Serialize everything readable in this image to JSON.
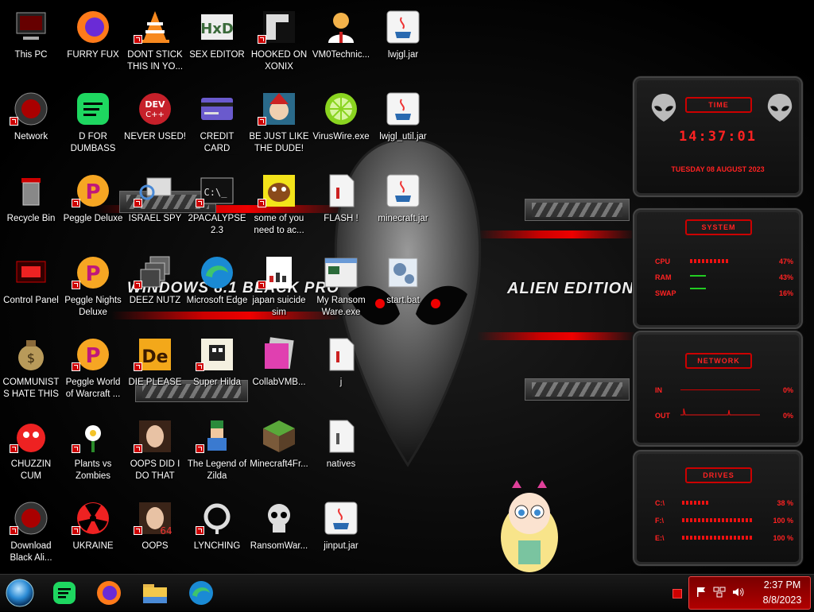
{
  "wallpaper": {
    "left_text": "WINDOWS 8.1 BLACK PRO",
    "right_text": "ALIEN EDITION 20",
    "accent": "#cc0000"
  },
  "desktop_icons": [
    {
      "label": "This PC",
      "icon": "computer-icon"
    },
    {
      "label": "Network",
      "icon": "network-icon"
    },
    {
      "label": "Recycle Bin",
      "icon": "recycle-bin-icon"
    },
    {
      "label": "Control Panel",
      "icon": "control-panel-icon"
    },
    {
      "label": "COMMUNISTS HATE THIS G...",
      "icon": "money-bag-icon"
    },
    {
      "label": "CHUZZIN CUM",
      "icon": "chuzzle-icon"
    },
    {
      "label": "Download Black Ali...",
      "icon": "alien-icon"
    },
    {
      "label": "FURRY FUX",
      "icon": "firefox-icon"
    },
    {
      "label": "D FOR DUMBASS",
      "icon": "spotify-icon"
    },
    {
      "label": "Peggle Deluxe",
      "icon": "peggle-icon"
    },
    {
      "label": "Peggle Nights Deluxe",
      "icon": "peggle-icon"
    },
    {
      "label": "Peggle World of Warcraft ...",
      "icon": "peggle-icon"
    },
    {
      "label": "Plants vs Zombies",
      "icon": "flower-icon"
    },
    {
      "label": "UKRAINE",
      "icon": "radiation-icon"
    },
    {
      "label": "DONT STICK THIS IN YO...",
      "icon": "vlc-cone-icon"
    },
    {
      "label": "NEVER USED!",
      "icon": "dev-cpp-icon"
    },
    {
      "label": "ISRAEL SPY",
      "icon": "magnifier-icon"
    },
    {
      "label": "DEEZ NUTZ",
      "icon": "stacked-windows-icon"
    },
    {
      "label": "DIE PLEASE",
      "icon": "director-icon"
    },
    {
      "label": "OOPS DID I DO THAT",
      "icon": "portrait-icon"
    },
    {
      "label": "OOPS",
      "icon": "portrait-icon"
    },
    {
      "label": "SEX EDITOR",
      "icon": "hxd-icon"
    },
    {
      "label": "CREDIT CARD CHECKER",
      "icon": "credit-card-icon"
    },
    {
      "label": "2PACALYPSE 2.3",
      "icon": "terminal-icon"
    },
    {
      "label": "Microsoft Edge",
      "icon": "edge-icon"
    },
    {
      "label": "Super Hilda",
      "icon": "pixel-game-icon"
    },
    {
      "label": "The Legend of Zilda",
      "icon": "pixel-hero-icon"
    },
    {
      "label": "LYNCHING",
      "icon": "rope-icon"
    },
    {
      "label": "HOOKED ON XONIX",
      "icon": "xonix-icon"
    },
    {
      "label": "BE JUST LIKE THE DUDE!",
      "icon": "elf-icon"
    },
    {
      "label": "some of you need to ac...",
      "icon": "dog-icon"
    },
    {
      "label": "japan suicide sim",
      "icon": "document-icon"
    },
    {
      "label": "CollabVMB...",
      "icon": "folder-pink-icon"
    },
    {
      "label": "Minecraft4Fr...",
      "icon": "grass-block-icon"
    },
    {
      "label": "RansomWar...",
      "icon": "skull-icon"
    },
    {
      "label": "VM0Technic...",
      "icon": "doctor-icon"
    },
    {
      "label": "VirusWire.exe",
      "icon": "lime-icon"
    },
    {
      "label": "FLASH !",
      "icon": "file-icon"
    },
    {
      "label": "My Ransom Ware.exe",
      "icon": "app-window-icon"
    },
    {
      "label": "j",
      "icon": "file-icon"
    },
    {
      "label": "natives",
      "icon": "file-icon"
    },
    {
      "label": "jinput.jar",
      "icon": "java-icon"
    },
    {
      "label": "lwjgl.jar",
      "icon": "java-icon"
    },
    {
      "label": "lwjgl_util.jar",
      "icon": "java-icon"
    },
    {
      "label": "minecraft.jar",
      "icon": "java-icon"
    },
    {
      "label": "start.bat",
      "icon": "batch-gear-icon"
    }
  ],
  "gadgets": {
    "time": {
      "title": "TIME",
      "clock": "14:37:01",
      "date": "TUESDAY 08 AUGUST 2023"
    },
    "system": {
      "title": "SYSTEM",
      "rows": [
        {
          "label": "CPU",
          "value": "47%",
          "fill": 0.47
        },
        {
          "label": "RAM",
          "value": "43%",
          "fill": 0.43
        },
        {
          "label": "SWAP",
          "value": "16%",
          "fill": 0.16
        }
      ]
    },
    "network": {
      "title": "NETWORK",
      "rows": [
        {
          "label": "IN",
          "value": "0%"
        },
        {
          "label": "OUT",
          "value": "0%"
        }
      ]
    },
    "drives": {
      "title": "DRIVES",
      "rows": [
        {
          "label": "C:\\",
          "value": "38 %",
          "fill": 0.38
        },
        {
          "label": "F:\\",
          "value": "100 %",
          "fill": 1.0
        },
        {
          "label": "E:\\",
          "value": "100 %",
          "fill": 1.0
        }
      ]
    }
  },
  "taskbar": {
    "pinned": [
      {
        "name": "start-orb",
        "icon": "start-orb-icon"
      },
      {
        "name": "spotify",
        "icon": "spotify-icon"
      },
      {
        "name": "firefox",
        "icon": "firefox-icon"
      },
      {
        "name": "file-explorer",
        "icon": "folder-icon"
      },
      {
        "name": "edge",
        "icon": "edge-icon"
      }
    ],
    "clock_time": "2:37 PM",
    "clock_date": "8/8/2023"
  }
}
